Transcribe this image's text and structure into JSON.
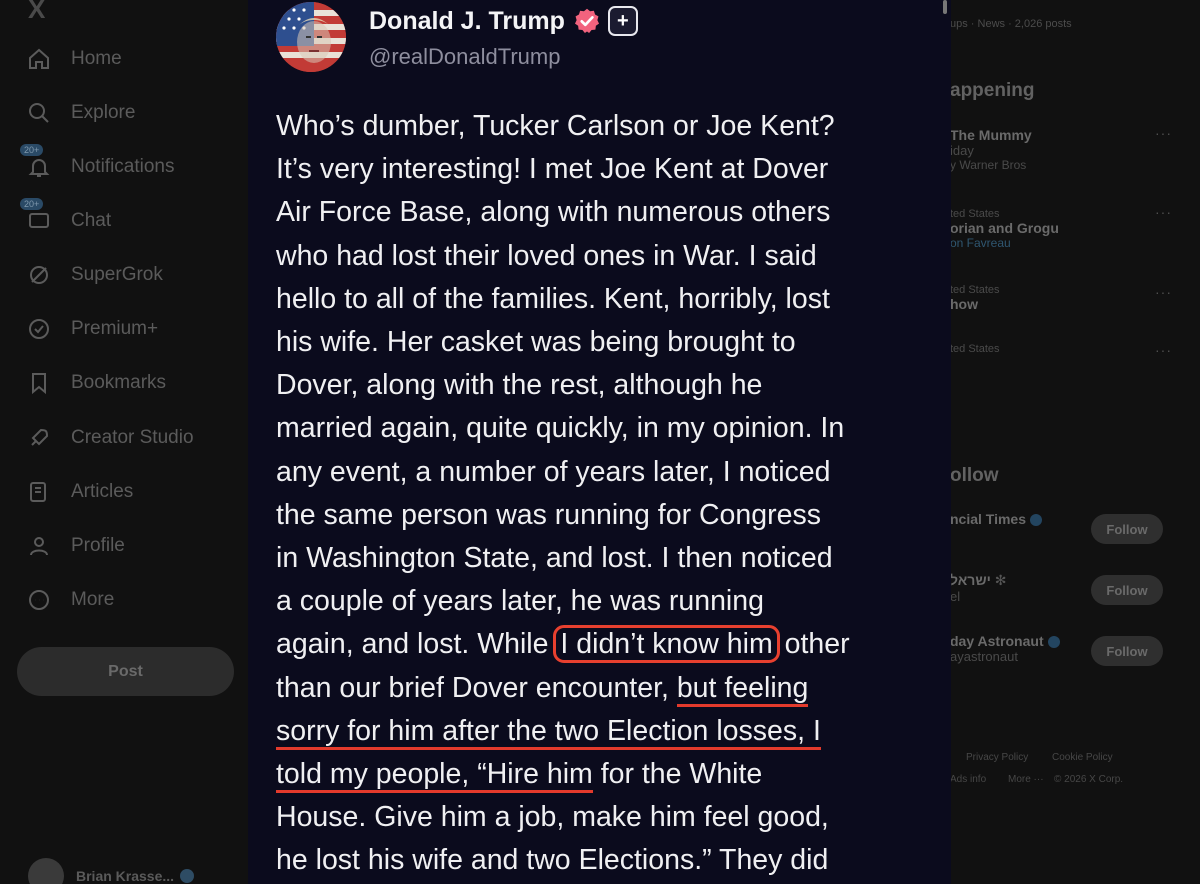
{
  "background": {
    "nav": {
      "logo": "X",
      "items": [
        {
          "label": "Home",
          "icon": "home-icon"
        },
        {
          "label": "Explore",
          "icon": "search-icon"
        },
        {
          "label": "Notifications",
          "icon": "bell-icon",
          "badge": "20+"
        },
        {
          "label": "Chat",
          "icon": "chat-icon",
          "badge": "20+"
        },
        {
          "label": "SuperGrok",
          "icon": "grok-icon"
        },
        {
          "label": "Premium+",
          "icon": "premium-icon"
        },
        {
          "label": "Bookmarks",
          "icon": "bookmark-icon"
        },
        {
          "label": "Creator Studio",
          "icon": "rocket-icon"
        },
        {
          "label": "Articles",
          "icon": "article-icon"
        },
        {
          "label": "Profile",
          "icon": "person-icon"
        },
        {
          "label": "More",
          "icon": "more-icon"
        }
      ],
      "post_button": "Post",
      "user_name": "Brian Krasse..."
    },
    "right": {
      "top_text": "ups · News · 2,026 posts",
      "happening_title": "appening",
      "trends": [
        {
          "name": "The Mummy",
          "context": "iday",
          "sub": "y Warner Bros",
          "sub_link": ""
        },
        {
          "context": "ted States",
          "name": "orian and Grogu",
          "sub": "",
          "sub_link": "on Favreau"
        },
        {
          "context": "ted States",
          "name": "how",
          "sub": "",
          "sub_link": ""
        },
        {
          "context": "ted States",
          "name": "",
          "sub": "",
          "sub_link": ""
        }
      ],
      "who_to_follow_title": "ollow",
      "follow_suggestions": [
        {
          "name": "ncial Times",
          "handle": "",
          "button": "Follow"
        },
        {
          "name": "ישראל",
          "handle": "el",
          "button": "Follow"
        },
        {
          "name": "day Astronaut",
          "handle": "ayastronaut",
          "button": "Follow"
        }
      ],
      "footer": [
        "Privacy Policy",
        "Cookie Policy",
        "Ads info",
        "More ···",
        "© 2026 X Corp."
      ]
    }
  },
  "modal": {
    "author_name": "Donald J. Trump",
    "handle": "@realDonaldTrump",
    "plus_badge": "+",
    "colors": {
      "highlight": "#e8402f",
      "verified": "#f2637e",
      "background": "#0b0b1d"
    },
    "post_lines": {
      "l1": "Who’s dumber, Tucker Carlson or Joe Kent?",
      "l2": "It’s very interesting! I met Joe Kent at Dover",
      "l3": "Air Force Base, along with numerous others",
      "l4": "who had lost their loved ones in War. I said",
      "l5": "hello to all of the families. Kent, horribly, lost",
      "l6": "his wife. Her casket was being brought to",
      "l7": "Dover, along with the rest, although he",
      "l8": "married again, quite quickly, in my opinion. In",
      "l9": "any event, a number of years later, I noticed",
      "l10": "the same person was running for Congress",
      "l11": "in Washington State, and lost. I then noticed",
      "l12": "a couple of years later, he was running",
      "l13a": "again, and lost. While ",
      "l13b": "I didn’t know him",
      "l13c": " other",
      "l14a": "than our brief Dover encounter, ",
      "l14b": "but feeling",
      "l15": "sorry for him after the two Election losses, I",
      "l16a": "told my people, “Hire him",
      "l16b": " for the White",
      "l17": "House. Give him a job, make him feel good,",
      "l18": "he lost his wife and two Elections.” They did"
    }
  }
}
